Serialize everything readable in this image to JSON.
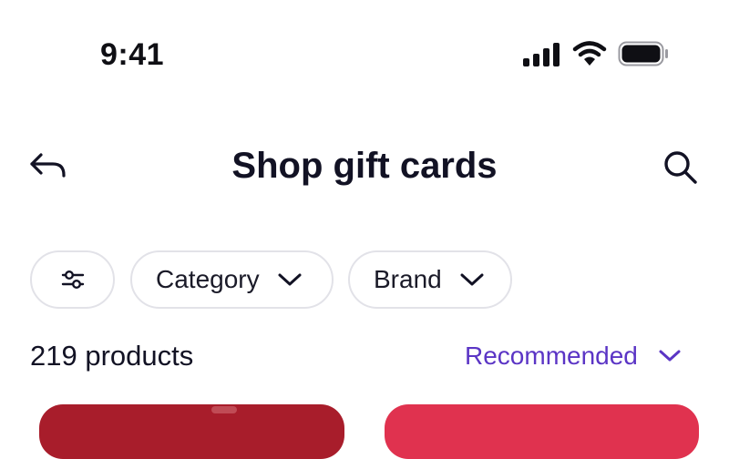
{
  "status_bar": {
    "time": "9:41",
    "icons": [
      "signal-icon",
      "wifi-icon",
      "battery-icon"
    ]
  },
  "header": {
    "title": "Shop gift cards",
    "back_icon": "back-arrow-icon",
    "search_icon": "search-icon"
  },
  "filters": {
    "filter_icon": "sliders-icon",
    "chips": [
      {
        "label": "Category",
        "icon": "chevron-down-icon"
      },
      {
        "label": "Brand",
        "icon": "chevron-down-icon"
      }
    ]
  },
  "results": {
    "count_label": "219 products",
    "sort_label": "Recommended"
  },
  "colors": {
    "text": "#121224",
    "accent": "#5b35c5",
    "chip_border": "#e2e2e8",
    "card_red": "#a81d2b",
    "card_pink": "#e0324f"
  }
}
